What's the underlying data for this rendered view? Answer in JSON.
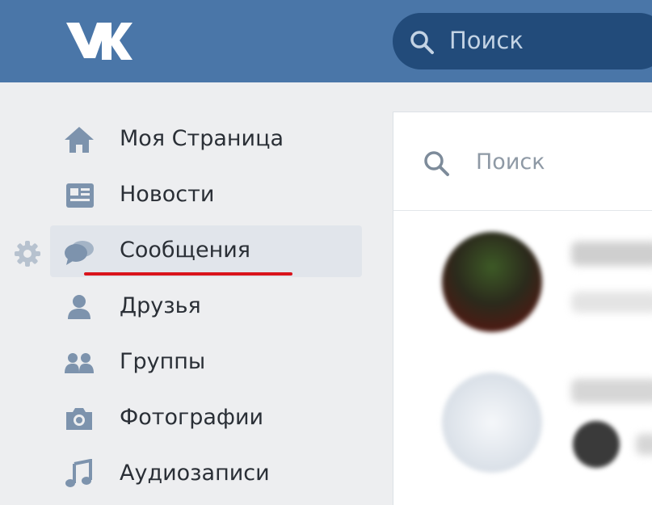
{
  "header": {
    "logo": "VK",
    "search_placeholder": "Поиск"
  },
  "sidebar": {
    "items": [
      {
        "label": "Моя Страница",
        "icon": "home-icon"
      },
      {
        "label": "Новости",
        "icon": "news-icon"
      },
      {
        "label": "Сообщения",
        "icon": "messages-icon",
        "active": true
      },
      {
        "label": "Друзья",
        "icon": "friends-icon"
      },
      {
        "label": "Группы",
        "icon": "groups-icon"
      },
      {
        "label": "Фотографии",
        "icon": "camera-icon"
      },
      {
        "label": "Аудиозаписи",
        "icon": "music-icon"
      }
    ]
  },
  "messages_panel": {
    "search_placeholder": "Поиск"
  },
  "colors": {
    "header_bg": "#4a76a8",
    "underline": "#d9141c",
    "icon": "#7d93ad"
  }
}
